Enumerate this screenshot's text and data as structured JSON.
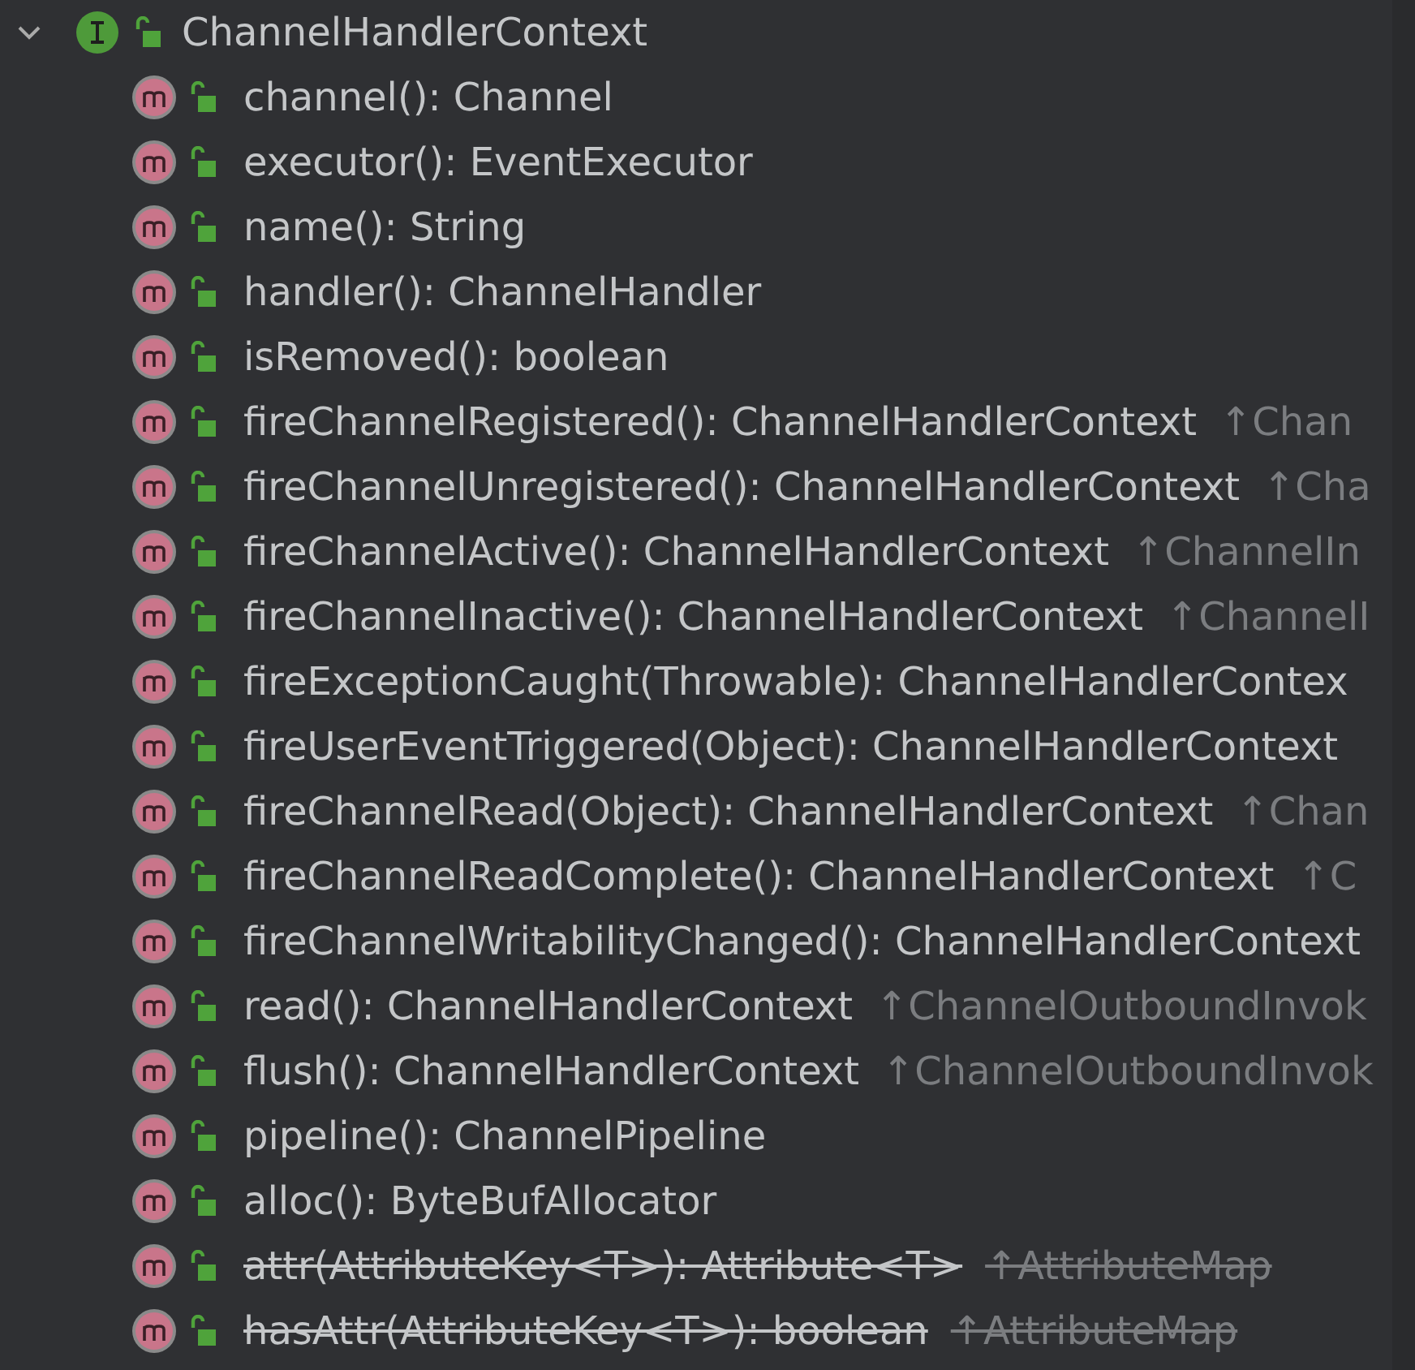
{
  "structure": {
    "root": {
      "name": "ChannelHandlerContext",
      "kind": "interface",
      "expanded": true,
      "children": [
        {
          "kind": "method",
          "signature": "channel(): Channel",
          "deprecated": false
        },
        {
          "kind": "method",
          "signature": "executor(): EventExecutor",
          "deprecated": false
        },
        {
          "kind": "method",
          "signature": "name(): String",
          "deprecated": false
        },
        {
          "kind": "method",
          "signature": "handler(): ChannelHandler",
          "deprecated": false
        },
        {
          "kind": "method",
          "signature": "isRemoved(): boolean",
          "deprecated": false
        },
        {
          "kind": "method",
          "signature": "fireChannelRegistered(): ChannelHandlerContext",
          "inherited": "↑Chan",
          "deprecated": false
        },
        {
          "kind": "method",
          "signature": "fireChannelUnregistered(): ChannelHandlerContext",
          "inherited": "↑Cha",
          "deprecated": false
        },
        {
          "kind": "method",
          "signature": "fireChannelActive(): ChannelHandlerContext",
          "inherited": "↑ChannelIn",
          "deprecated": false
        },
        {
          "kind": "method",
          "signature": "fireChannelInactive(): ChannelHandlerContext",
          "inherited": "↑ChannelI",
          "deprecated": false
        },
        {
          "kind": "method",
          "signature": "fireExceptionCaught(Throwable): ChannelHandlerContex",
          "deprecated": false
        },
        {
          "kind": "method",
          "signature": "fireUserEventTriggered(Object): ChannelHandlerContext",
          "deprecated": false
        },
        {
          "kind": "method",
          "signature": "fireChannelRead(Object): ChannelHandlerContext",
          "inherited": "↑Chan",
          "deprecated": false
        },
        {
          "kind": "method",
          "signature": "fireChannelReadComplete(): ChannelHandlerContext",
          "inherited": "↑C",
          "deprecated": false
        },
        {
          "kind": "method",
          "signature": "fireChannelWritabilityChanged(): ChannelHandlerContext",
          "deprecated": false
        },
        {
          "kind": "method",
          "signature": "read(): ChannelHandlerContext",
          "inherited": "↑ChannelOutboundInvok",
          "deprecated": false
        },
        {
          "kind": "method",
          "signature": "flush(): ChannelHandlerContext",
          "inherited": "↑ChannelOutboundInvok",
          "deprecated": false
        },
        {
          "kind": "method",
          "signature": "pipeline(): ChannelPipeline",
          "deprecated": false
        },
        {
          "kind": "method",
          "signature": "alloc(): ByteBufAllocator",
          "deprecated": false
        },
        {
          "kind": "method",
          "signature": "attr(AttributeKey<T>): Attribute<T>",
          "inherited": "↑AttributeMap",
          "deprecated": true
        },
        {
          "kind": "method",
          "signature": "hasAttr(AttributeKey<T>): boolean",
          "inherited": "↑AttributeMap",
          "deprecated": true
        }
      ]
    }
  }
}
